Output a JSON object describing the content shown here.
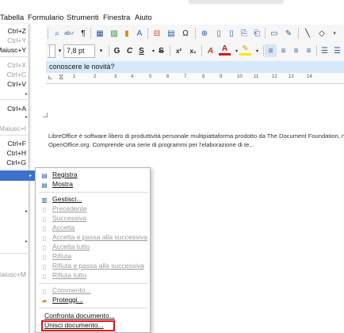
{
  "menubar": {
    "items": [
      "Tabella",
      "Formulario",
      "Strumenti",
      "Finestra",
      "Aiuto"
    ]
  },
  "toolbar": {
    "font_size_value": "7,8 pt",
    "buttons": [
      "find-replace-icon",
      "spelling-icon",
      "formatting-marks-icon",
      "table-icon",
      "image-icon",
      "chart-icon",
      "textbox-icon",
      "page-break-icon",
      "field-icon",
      "special-character-icon",
      "hyperlink-icon",
      "footnote-icon",
      "endnote-icon",
      "bookmark-icon",
      "cross-reference-icon",
      "comment-icon",
      "track-changes-icon",
      "line-icon",
      "shapes-icon"
    ],
    "format_buttons": {
      "bold": "G",
      "italic": "C",
      "underline": "S",
      "strike": "S",
      "superscript": "x²",
      "subscript": "x₂"
    }
  },
  "infobar": {
    "text": "conoscere le novità?"
  },
  "ruler": {
    "numbers": [
      "1",
      "2",
      "3",
      "4",
      "5",
      "6",
      "7",
      "8",
      "9",
      "10",
      "11",
      "12",
      "13",
      "14"
    ]
  },
  "document": {
    "line1": "LibreOffice è software libero di produttività personale multipiattaforma prodotto da The Document Foundation, nato dal fork",
    "line2": "OpenOffice.org. Comprende una serie di programmi per l'elaborazione di te..."
  },
  "left_menu": {
    "shortcuts": [
      {
        "label": "Ctrl+Z",
        "dim": false
      },
      {
        "label": "Ctrl+Y",
        "dim": true
      },
      {
        "label": "Maiusc+Y",
        "dim": false
      },
      {
        "label": "Ctrl+X",
        "dim": true
      },
      {
        "label": "Ctrl+C",
        "dim": true
      },
      {
        "label": "Ctrl+V",
        "dim": false
      },
      {
        "label": "Ctrl+A",
        "dim": false
      },
      {
        "label": "Maiusc+I",
        "dim": true
      },
      {
        "label": "Ctrl+F",
        "dim": false
      },
      {
        "label": "Ctrl+H",
        "dim": false
      },
      {
        "label": "Ctrl+G",
        "dim": false
      },
      {
        "label": "Maiusc+M",
        "dim": true
      }
    ]
  },
  "submenu": {
    "items": [
      {
        "label": "Registra",
        "icon": "record-icon",
        "dim": false
      },
      {
        "label": "Mostra",
        "icon": "show-changes-icon",
        "dim": false
      },
      {
        "label": "Gestisci...",
        "icon": "manage-icon",
        "dim": false
      },
      {
        "label": "Precedente",
        "icon": "previous-icon",
        "dim": true
      },
      {
        "label": "Successiva",
        "icon": "next-icon",
        "dim": true
      },
      {
        "label": "Accetta",
        "icon": "accept-icon",
        "dim": true
      },
      {
        "label": "Accetta e passa alla successiva",
        "icon": "accept-next-icon",
        "dim": true
      },
      {
        "label": "Accetta tutto",
        "icon": "accept-all-icon",
        "dim": true
      },
      {
        "label": "Rifiuta",
        "icon": "reject-icon",
        "dim": true
      },
      {
        "label": "Rifiuta e passa alla successiva",
        "icon": "reject-next-icon",
        "dim": true
      },
      {
        "label": "Rifiuta tutto",
        "icon": "reject-all-icon",
        "dim": true
      },
      {
        "label": "Commento...",
        "icon": "comment-icon",
        "dim": true
      },
      {
        "label": "Proteggi...",
        "icon": "protect-icon",
        "dim": false
      },
      {
        "label": "Confronta documento...",
        "icon": "",
        "dim": false
      },
      {
        "label": "Unisci documento...",
        "icon": "",
        "dim": false
      }
    ]
  },
  "colors": {
    "highlight": "#3c72c9",
    "infobar": "#d6e9fb",
    "callout": "#e0101a"
  }
}
